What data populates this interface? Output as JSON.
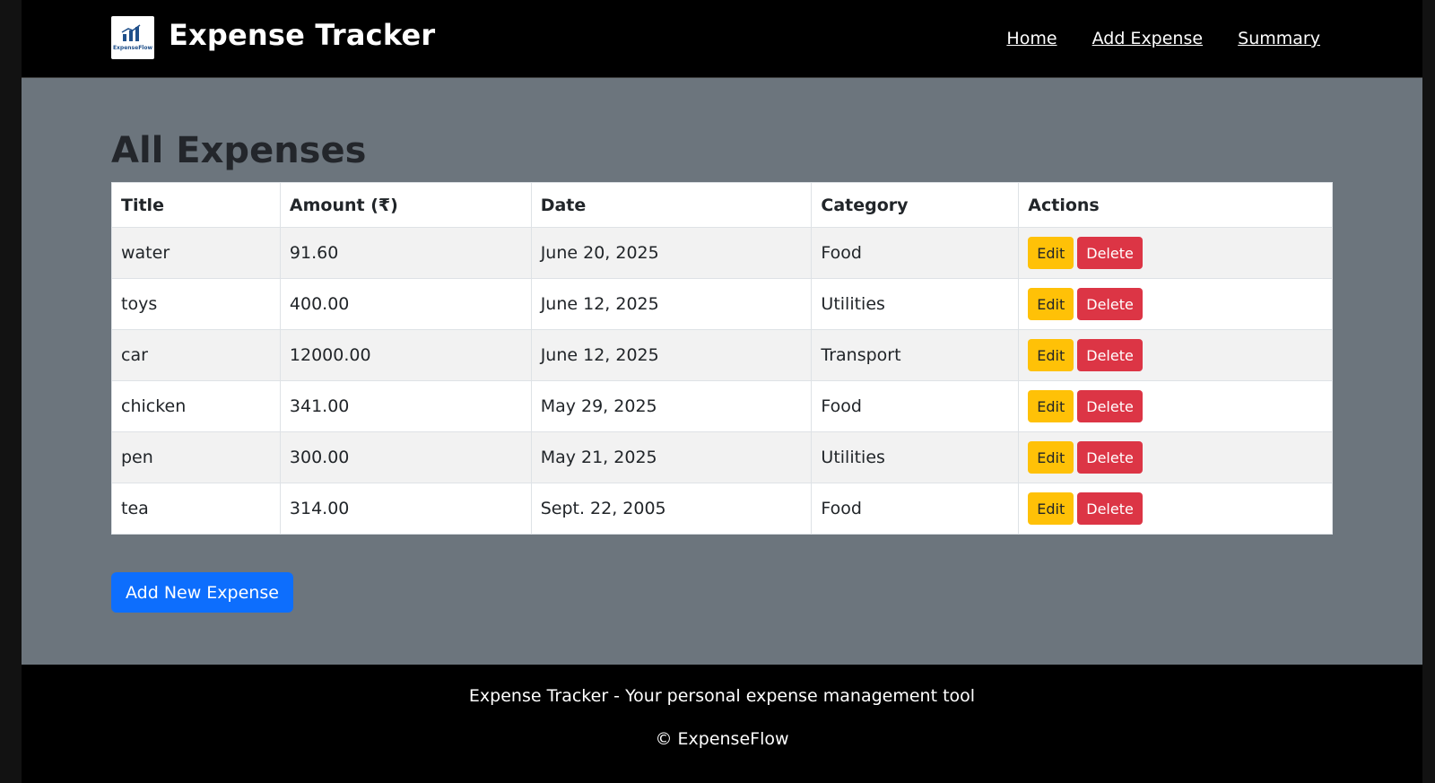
{
  "header": {
    "logo_text": "ExpenseFlow",
    "brand": "Expense Tracker",
    "nav": [
      {
        "label": "Home"
      },
      {
        "label": "Add Expense"
      },
      {
        "label": "Summary"
      }
    ]
  },
  "main": {
    "title": "All Expenses",
    "table": {
      "columns": [
        "Title",
        "Amount (₹)",
        "Date",
        "Category",
        "Actions"
      ],
      "rows": [
        {
          "title": "water",
          "amount": "91.60",
          "date": "June 20, 2025",
          "category": "Food"
        },
        {
          "title": "toys",
          "amount": "400.00",
          "date": "June 12, 2025",
          "category": "Utilities"
        },
        {
          "title": "car",
          "amount": "12000.00",
          "date": "June 12, 2025",
          "category": "Transport"
        },
        {
          "title": "chicken",
          "amount": "341.00",
          "date": "May 29, 2025",
          "category": "Food"
        },
        {
          "title": "pen",
          "amount": "300.00",
          "date": "May 21, 2025",
          "category": "Utilities"
        },
        {
          "title": "tea",
          "amount": "314.00",
          "date": "Sept. 22, 2005",
          "category": "Food"
        }
      ],
      "edit_label": "Edit",
      "delete_label": "Delete"
    },
    "add_button": "Add New Expense"
  },
  "footer": {
    "tagline": "Expense Tracker - Your personal expense management tool",
    "copyright": "© ExpenseFlow"
  },
  "colors": {
    "navbar": "#000000",
    "main_bg": "#6c757d",
    "edit": "#ffc107",
    "delete": "#dc3545",
    "primary": "#0d6efd"
  }
}
